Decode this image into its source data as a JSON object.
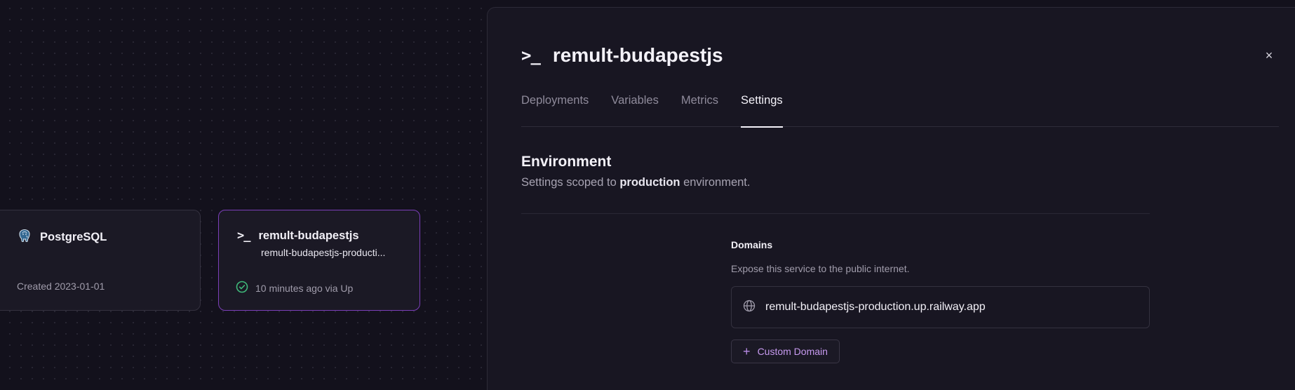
{
  "canvas": {
    "postgres_card": {
      "name": "PostgreSQL",
      "meta": "Created 2023-01-01",
      "icon": "postgres-elephant-icon"
    },
    "service_card": {
      "name": "remult-budapestjs",
      "subtitle": "remult-budapestjs-producti...",
      "status": "10 minutes ago via Up",
      "icon": "terminal-icon",
      "status_icon": "check-circle-icon",
      "status_color": "#3fb87a",
      "accent_color": "#7b3fb8"
    }
  },
  "panel": {
    "title": "remult-budapestjs",
    "icon": "terminal-icon",
    "close_label": "×",
    "tabs": [
      {
        "label": "Deployments",
        "active": false
      },
      {
        "label": "Variables",
        "active": false
      },
      {
        "label": "Metrics",
        "active": false
      },
      {
        "label": "Settings",
        "active": true
      }
    ],
    "environment": {
      "title": "Environment",
      "desc_prefix": "Settings scoped to ",
      "desc_env": "production",
      "desc_suffix": " environment."
    },
    "domains": {
      "title": "Domains",
      "description": "Expose this service to the public internet.",
      "domain": "remult-budapestjs-production.up.railway.app",
      "domain_icon": "globe-icon",
      "custom_button_label": "Custom Domain",
      "custom_button_icon": "plus-icon"
    }
  }
}
